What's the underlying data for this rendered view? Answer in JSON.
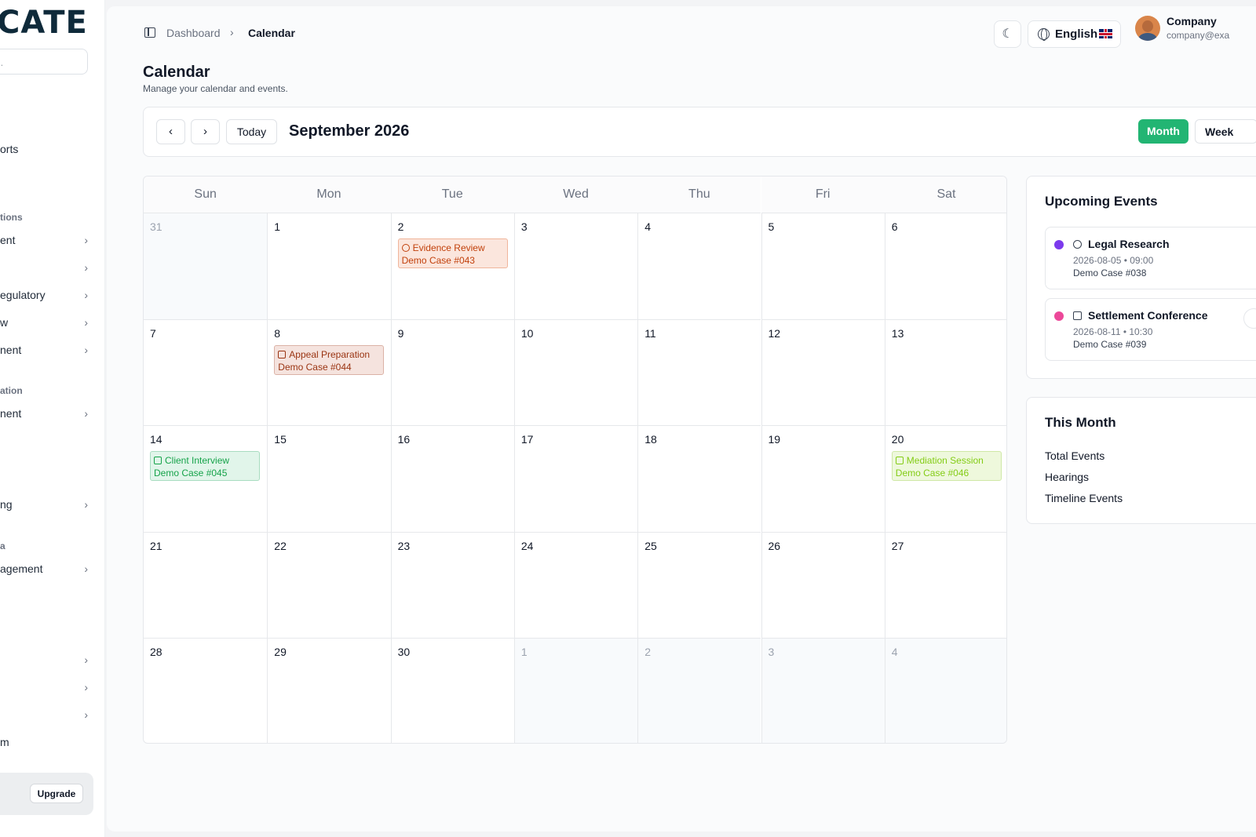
{
  "sidebar": {
    "logo": "CATE",
    "search_placeholder": "..",
    "items": [
      {
        "label": "orts",
        "chevron": false
      },
      {
        "label": "ent",
        "chevron": true
      },
      {
        "label": "",
        "chevron": true
      },
      {
        "label": "egulatory",
        "chevron": true
      },
      {
        "label": "w",
        "chevron": true
      },
      {
        "label": "nent",
        "chevron": true
      },
      {
        "label": "nent",
        "chevron": true
      },
      {
        "label": "ng",
        "chevron": true
      },
      {
        "label": "agement",
        "chevron": true
      },
      {
        "label": "",
        "chevron": true
      },
      {
        "label": "",
        "chevron": true
      },
      {
        "label": "",
        "chevron": true
      },
      {
        "label": "m",
        "chevron": false
      }
    ],
    "groups": [
      "tions",
      "ation",
      "a"
    ],
    "upgrade_label": "Upgrade"
  },
  "topbar": {
    "breadcrumb_root": "Dashboard",
    "breadcrumb_current": "Calendar",
    "language": "English",
    "user_name": "Company",
    "user_email": "company@exa"
  },
  "page": {
    "title": "Calendar",
    "subtitle": "Manage your calendar and events."
  },
  "toolbar": {
    "prev": "‹",
    "next": "›",
    "today": "Today",
    "month_label": "September 2026",
    "view_month": "Month",
    "view_week": "Week"
  },
  "calendar": {
    "weekdays": [
      "Sun",
      "Mon",
      "Tue",
      "Wed",
      "Thu",
      "Fri",
      "Sat"
    ],
    "weeks": [
      [
        {
          "d": "31",
          "out": true
        },
        {
          "d": "1"
        },
        {
          "d": "2"
        },
        {
          "d": "3"
        },
        {
          "d": "4"
        },
        {
          "d": "5"
        },
        {
          "d": "6"
        }
      ],
      [
        {
          "d": "7"
        },
        {
          "d": "8"
        },
        {
          "d": "9"
        },
        {
          "d": "10"
        },
        {
          "d": "11"
        },
        {
          "d": "12"
        },
        {
          "d": "13"
        }
      ],
      [
        {
          "d": "14"
        },
        {
          "d": "15"
        },
        {
          "d": "16"
        },
        {
          "d": "17"
        },
        {
          "d": "18"
        },
        {
          "d": "19"
        },
        {
          "d": "20"
        }
      ],
      [
        {
          "d": "21"
        },
        {
          "d": "22"
        },
        {
          "d": "23"
        },
        {
          "d": "24"
        },
        {
          "d": "25"
        },
        {
          "d": "26"
        },
        {
          "d": "27"
        }
      ],
      [
        {
          "d": "28"
        },
        {
          "d": "29"
        },
        {
          "d": "30"
        },
        {
          "d": "1",
          "out": true
        },
        {
          "d": "2",
          "out": true
        },
        {
          "d": "3",
          "out": true
        },
        {
          "d": "4",
          "out": true
        }
      ]
    ],
    "events": [
      {
        "week": 0,
        "day": 2,
        "title": "Evidence Review",
        "case": "Demo Case #043",
        "icon": "clock-icon",
        "color": "#c2410c",
        "bg": "#fbe6dd",
        "border": "#f0b59b"
      },
      {
        "week": 1,
        "day": 1,
        "title": "Appeal Preparation",
        "case": "Demo Case #044",
        "icon": "document-icon",
        "color": "#9a3412",
        "bg": "#f5e3de",
        "border": "#dbb2a6"
      },
      {
        "week": 2,
        "day": 0,
        "title": "Client Interview",
        "case": "Demo Case #045",
        "icon": "calendar-icon",
        "color": "#16a34a",
        "bg": "#e1f5ea",
        "border": "#a8dcc0"
      },
      {
        "week": 2,
        "day": 6,
        "title": "Mediation Session",
        "case": "Demo Case #046",
        "icon": "calendar-icon",
        "color": "#84cc16",
        "bg": "#eef8dc",
        "border": "#cfe8a6"
      }
    ]
  },
  "upcoming": {
    "title": "Upcoming Events",
    "items": [
      {
        "title": "Legal Research",
        "meta": "2026-08-05 • 09:00",
        "case": "Demo Case #038",
        "dot": "#7c3aed",
        "icon": "clock-icon"
      },
      {
        "title": "Settlement Conference",
        "meta": "2026-08-11 • 10:30",
        "case": "Demo Case #039",
        "dot": "#ec4899",
        "icon": "calendar-icon"
      }
    ]
  },
  "this_month": {
    "title": "This Month",
    "stats": [
      "Total Events",
      "Hearings",
      "Timeline Events"
    ]
  },
  "colors": {
    "accent": "#22b573"
  }
}
